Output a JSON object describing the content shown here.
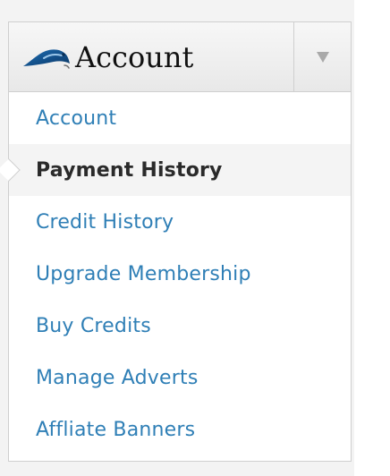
{
  "menu": {
    "header": {
      "title": "Account",
      "icon": "bird-icon",
      "dropdown_icon": "chevron-down-icon"
    },
    "items": [
      {
        "label": "Account",
        "active": false
      },
      {
        "label": "Payment History",
        "active": true
      },
      {
        "label": "Credit History",
        "active": false
      },
      {
        "label": "Upgrade Membership",
        "active": false
      },
      {
        "label": "Buy Credits",
        "active": false
      },
      {
        "label": "Manage Adverts",
        "active": false
      },
      {
        "label": "Affliate Banners",
        "active": false
      }
    ]
  },
  "colors": {
    "link": "#2f7fb6",
    "active_text": "#2a2a2a",
    "border": "#cfcfcf",
    "background": "#f3f3f3",
    "active_background": "#f4f4f4"
  }
}
